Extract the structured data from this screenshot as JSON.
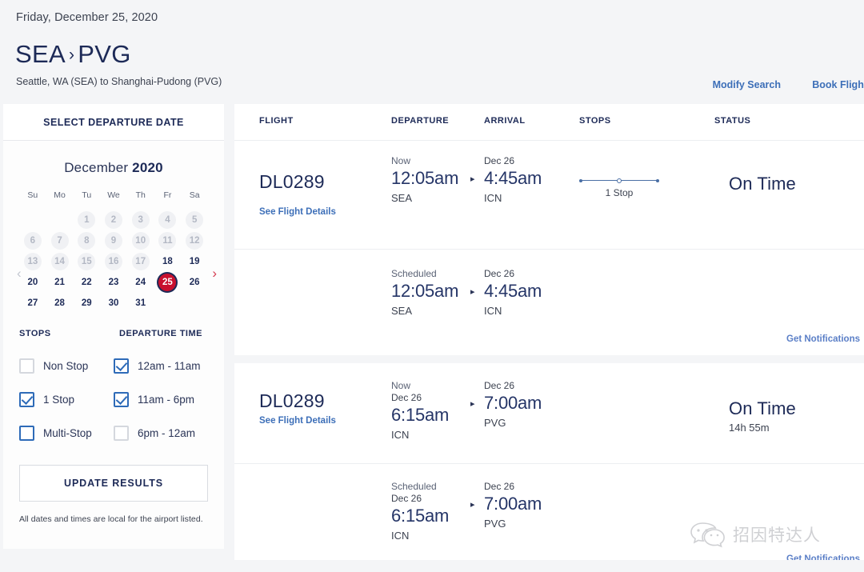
{
  "header": {
    "date": "Friday, December 25, 2020",
    "origin_code": "SEA",
    "separator": "›",
    "dest_code": "PVG",
    "subtitle": "Seattle, WA (SEA) to Shanghai-Pudong (PVG)",
    "modify_search_label": "Modify Search",
    "book_flight_label": "Book Flight"
  },
  "sidebar": {
    "title": "SELECT DEPARTURE DATE",
    "calendar": {
      "month": "December",
      "year": "2020",
      "prev_arrow": "‹",
      "next_arrow": "›",
      "dow": [
        "Su",
        "Mo",
        "Tu",
        "We",
        "Th",
        "Fr",
        "Sa"
      ],
      "lead_blanks": 2,
      "days": [
        {
          "n": "1",
          "state": "disabled"
        },
        {
          "n": "2",
          "state": "disabled"
        },
        {
          "n": "3",
          "state": "disabled"
        },
        {
          "n": "4",
          "state": "disabled"
        },
        {
          "n": "5",
          "state": "disabled"
        },
        {
          "n": "6",
          "state": "disabled"
        },
        {
          "n": "7",
          "state": "disabled"
        },
        {
          "n": "8",
          "state": "disabled"
        },
        {
          "n": "9",
          "state": "disabled"
        },
        {
          "n": "10",
          "state": "disabled"
        },
        {
          "n": "11",
          "state": "disabled"
        },
        {
          "n": "12",
          "state": "disabled"
        },
        {
          "n": "13",
          "state": "disabled"
        },
        {
          "n": "14",
          "state": "disabled"
        },
        {
          "n": "15",
          "state": "disabled"
        },
        {
          "n": "16",
          "state": "disabled"
        },
        {
          "n": "17",
          "state": "disabled"
        },
        {
          "n": "18",
          "state": "enabled"
        },
        {
          "n": "19",
          "state": "enabled"
        },
        {
          "n": "20",
          "state": "enabled"
        },
        {
          "n": "21",
          "state": "enabled"
        },
        {
          "n": "22",
          "state": "enabled"
        },
        {
          "n": "23",
          "state": "enabled"
        },
        {
          "n": "24",
          "state": "enabled"
        },
        {
          "n": "25",
          "state": "selected"
        },
        {
          "n": "26",
          "state": "enabled"
        },
        {
          "n": "27",
          "state": "enabled"
        },
        {
          "n": "28",
          "state": "enabled"
        },
        {
          "n": "29",
          "state": "enabled"
        },
        {
          "n": "30",
          "state": "enabled"
        },
        {
          "n": "31",
          "state": "enabled"
        }
      ]
    },
    "filters": {
      "stops_heading": "STOPS",
      "departure_heading": "DEPARTURE TIME",
      "stops_options": [
        {
          "label": "Non Stop",
          "checked": false,
          "enabled": false
        },
        {
          "label": "1 Stop",
          "checked": true,
          "enabled": true
        },
        {
          "label": "Multi-Stop",
          "checked": false,
          "enabled": true
        }
      ],
      "departure_options": [
        {
          "label": "12am - 11am",
          "checked": true,
          "enabled": true
        },
        {
          "label": "11am - 6pm",
          "checked": true,
          "enabled": true
        },
        {
          "label": "6pm - 12am",
          "checked": false,
          "enabled": false
        }
      ]
    },
    "update_button": "UPDATE RESULTS",
    "note": "All dates and times are local for the airport listed."
  },
  "results": {
    "columns": {
      "flight": "FLIGHT",
      "departure": "DEPARTURE",
      "arrival": "ARRIVAL",
      "stops": "STOPS",
      "status": "STATUS"
    },
    "groups": [
      {
        "flight_number": "DL0289",
        "details_link": "See Flight Details",
        "live": {
          "dep_prefix": "Now",
          "dep_date": "",
          "dep_time": "12:05am",
          "dep_code": "SEA",
          "arr_date": "Dec 26",
          "arr_time": "4:45am",
          "arr_code": "ICN",
          "stops_label": "1 Stop",
          "status": "On Time",
          "status_sub": ""
        },
        "scheduled": {
          "dep_prefix": "Scheduled",
          "dep_date": "",
          "dep_time": "12:05am",
          "dep_code": "SEA",
          "arr_date": "Dec 26",
          "arr_time": "4:45am",
          "arr_code": "ICN",
          "notifications_link": "Get Notifications"
        }
      },
      {
        "flight_number": "DL0289",
        "details_link": "See Flight Details",
        "live": {
          "dep_prefix": "Now",
          "dep_date": "Dec 26",
          "dep_time": "6:15am",
          "dep_code": "ICN",
          "arr_date": "Dec 26",
          "arr_time": "7:00am",
          "arr_code": "PVG",
          "stops_label": "",
          "status": "On Time",
          "status_sub": "14h 55m"
        },
        "scheduled": {
          "dep_prefix": "Scheduled",
          "dep_date": "Dec 26",
          "dep_time": "6:15am",
          "dep_code": "ICN",
          "arr_date": "Dec 26",
          "arr_time": "7:00am",
          "arr_code": "PVG",
          "notifications_link": "Get Notifications"
        }
      }
    ],
    "arrow_glyph": "▸"
  },
  "watermark": {
    "text": "招因特达人"
  },
  "colors": {
    "brand_navy": "#1d2a57",
    "accent_red": "#c8102e",
    "link_blue": "#3d6fb8",
    "page_bg": "#f4f5f7"
  }
}
